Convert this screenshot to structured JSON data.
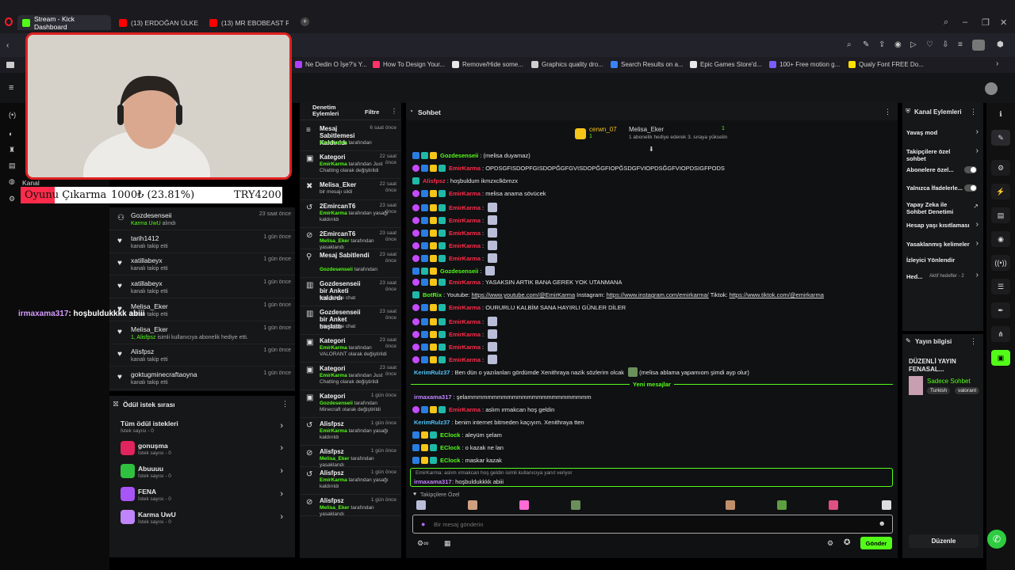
{
  "browser": {
    "tabs": [
      {
        "title": "Stream - Kick Dashboard",
        "color": "#53fc18"
      },
      {
        "title": "(13) ERDOĞAN ÜLKEYİ BO",
        "color": "#ff0000"
      },
      {
        "title": "(13) MR EBOBEAST REZİL",
        "color": "#ff0000"
      }
    ],
    "bookmarks": [
      "Ne Dedin O İşe?'s Y...",
      "How To Design Your...",
      "Remove/Hide some...",
      "Graphics quality dro...",
      "Search Results on a...",
      "Epic Games Store'd...",
      "100+ Free motion g...",
      "Qualy Font FREE Do..."
    ]
  },
  "overlay": {
    "goal_label": "Oyunu Çıkarma",
    "goal_amount": "1000₺ (23.81%)",
    "goal_total": "TRY4200",
    "goal_progress": 0.2381,
    "chat_user": "irmaxama317",
    "chat_text": ": hoşbuldukkkk abiii"
  },
  "leftnav": {
    "channel_label": "Kanal"
  },
  "activity": [
    {
      "name": "Gozdesenseii",
      "detail_green": "Karma UwU",
      "detail": " alındı",
      "time": "23 saat önce"
    },
    {
      "name": "tarih1412",
      "detail_green": "",
      "detail": "kanalı takip etti",
      "time": "1 gün önce"
    },
    {
      "name": "xatillabeyx",
      "detail_green": "",
      "detail": "kanalı takip etti",
      "time": "1 gün önce"
    },
    {
      "name": "xatillabeyx",
      "detail_green": "",
      "detail": "kanalı takip etti",
      "time": "1 gün önce"
    },
    {
      "name": "Melisa_Eker",
      "detail_green": "",
      "detail": "kanalı takip etti",
      "time": "1 gün önce"
    },
    {
      "name": "Melisa_Eker",
      "detail_green": "1, Alisfpsz",
      "detail": " isimli kullanıcıya abonelik hediye etti.",
      "time": "1 gün önce"
    },
    {
      "name": "Alisfpsz",
      "detail_green": "",
      "detail": "kanalı takip etti",
      "time": "1 gün önce"
    },
    {
      "name": "goktugminecraftaoyna",
      "detail_green": "",
      "detail": "kanalı takip etti",
      "time": "1 gün önce"
    }
  ],
  "rewards": {
    "title": "Ödül istek sırası",
    "all_label": "Tüm ödül istekleri",
    "all_count": "İstek sayısı - 0",
    "items": [
      {
        "name": "gonuşma",
        "count": "İstek sayısı - 0",
        "color": "#e0245e"
      },
      {
        "name": "Abuuuu",
        "count": "İstek sayısı - 0",
        "color": "#30c040"
      },
      {
        "name": "FENA",
        "count": "İstek sayısı - 0",
        "color": "#a855f7"
      },
      {
        "name": "Karma UwU",
        "count": "İstek sayısı - 0",
        "color": "#c084fc"
      }
    ]
  },
  "moderation": {
    "title": "Denetim Eylemleri",
    "filter": "Filtre",
    "items": [
      {
        "icon": "≡",
        "title": "Mesaj Sabitlemesi Kaldırıldı",
        "time": "6 saat önce",
        "actor": "EmirKarma",
        "desc": " tarafından"
      },
      {
        "icon": "▣",
        "title": "Kategori",
        "time": "22 saat önce",
        "actor": "EmirKarma",
        "desc": " tarafından Just Chatting olarak değiştirildi"
      },
      {
        "icon": "✖",
        "title": "Melisa_Eker",
        "time": "22 saat önce",
        "actor": "",
        "desc": "bir mesajı sildi"
      },
      {
        "icon": "↺",
        "title": "2EmircanT6",
        "time": "23 saat önce",
        "actor": "EmirKarma",
        "desc": " tarafından yasağı kaldırıldı"
      },
      {
        "icon": "⊘",
        "title": "2EmircanT6",
        "time": "23 saat önce",
        "actor": "Melisa_Eker",
        "desc": " tarafından yasaklandı"
      },
      {
        "icon": "⚲",
        "title": "Mesaj Sabitlendi",
        "time": "23 saat önce",
        "actor": "Gozdesenseii",
        "desc": " tarafından"
      },
      {
        "icon": "▥",
        "title": "Gozdesenseii bir Anketi kaldırdı",
        "time": "23 saat önce",
        "actor": "",
        "desc": "win or lose chat"
      },
      {
        "icon": "▥",
        "title": "Gozdesenseii bir Anket başlattı",
        "time": "23 saat önce",
        "actor": "",
        "desc": "win or lose chat"
      },
      {
        "icon": "▣",
        "title": "Kategori",
        "time": "23 saat önce",
        "actor": "EmirKarma",
        "desc": " tarafından VALORANT olarak değiştirildi"
      },
      {
        "icon": "▣",
        "title": "Kategori",
        "time": "23 saat önce",
        "actor": "EmirKarma",
        "desc": " tarafından Just Chatting olarak değiştirildi"
      },
      {
        "icon": "▣",
        "title": "Kategori",
        "time": "1 gün önce",
        "actor": "Gozdesenseii",
        "desc": " tarafından Minecraft olarak değiştirildi"
      },
      {
        "icon": "↺",
        "title": "Alisfpsz",
        "time": "1 gün önce",
        "actor": "EmirKarma",
        "desc": " tarafından yasağı kaldırıldı"
      },
      {
        "icon": "⊘",
        "title": "Alisfpsz",
        "time": "1 gün önce",
        "actor": "Melisa_Eker",
        "desc": " tarafından yasaklandı"
      },
      {
        "icon": "↺",
        "title": "Alisfpsz",
        "time": "1 gün önce",
        "actor": "EmirKarma",
        "desc": " tarafından yasağı kaldırıldı"
      },
      {
        "icon": "⊘",
        "title": "Alisfpsz",
        "time": "1 gün önce",
        "actor": "Melisa_Eker",
        "desc": " tarafından yasaklandı"
      }
    ]
  },
  "chat": {
    "title": "Sohbet",
    "top_gifter": {
      "name": "cerwn_07",
      "count": "1",
      "other": "Melisa_Eker",
      "other_count": "1",
      "note": "1 abonelik hediye ederek 3. sıraya yükselin"
    },
    "messages": [
      {
        "user": "Gozdesenseii",
        "color": "#53fc18",
        "badges": [
          "blue",
          "cyan",
          "gold"
        ],
        "text": ": (melisa duyamaz)",
        "emotes": 0
      },
      {
        "user": "EmirKarma",
        "color": "#ff2b4a",
        "badges": [
          "purple",
          "blue",
          "gold",
          "cyan"
        ],
        "text": ": OPDSGFISDOPFGISDOPĞGFGVISDOPĞGFIOPĞSDGFVIOPDSĞGFVIOPDSIGFPODS",
        "emotes": 0
      },
      {
        "user": "Alisfpsz",
        "color": "#ff2b4a",
        "badges": [
          "cyan"
        ],
        "text": ": hoşbuldum ikmzxclkbmzx",
        "emotes": 0
      },
      {
        "user": "EmirKarma",
        "color": "#ff2b4a",
        "badges": [
          "purple",
          "blue",
          "gold",
          "cyan"
        ],
        "text": ": melisa anama sövücek",
        "emotes": 0
      },
      {
        "user": "EmirKarma",
        "color": "#ff2b4a",
        "badges": [
          "purple",
          "blue",
          "gold",
          "cyan"
        ],
        "text": ":",
        "emotes": 1
      },
      {
        "user": "EmirKarma",
        "color": "#ff2b4a",
        "badges": [
          "purple",
          "blue",
          "gold",
          "cyan"
        ],
        "text": ":",
        "emotes": 1
      },
      {
        "user": "EmirKarma",
        "color": "#ff2b4a",
        "badges": [
          "purple",
          "blue",
          "gold",
          "cyan"
        ],
        "text": ":",
        "emotes": 1
      },
      {
        "user": "EmirKarma",
        "color": "#ff2b4a",
        "badges": [
          "purple",
          "blue",
          "gold",
          "cyan"
        ],
        "text": ":",
        "emotes": 1
      },
      {
        "user": "EmirKarma",
        "color": "#ff2b4a",
        "badges": [
          "purple",
          "blue",
          "gold",
          "cyan"
        ],
        "text": ":",
        "emotes": 1
      },
      {
        "user": "Gozdesenseii",
        "color": "#53fc18",
        "badges": [
          "blue",
          "cyan",
          "gold"
        ],
        "text": ":",
        "emotes": 1
      },
      {
        "user": "EmirKarma",
        "color": "#ff2b4a",
        "badges": [
          "purple",
          "blue",
          "gold",
          "cyan"
        ],
        "text": ": YASAKSIN ARTIK BANA GEREK YOK UTANMANA",
        "emotes": 0
      }
    ],
    "botrix": {
      "user": "BotRix",
      "prefix": ": Youtube: ",
      "yt": "https://www.youtube.com/@EmirKarma",
      "ig_label": " Instagram: ",
      "ig": "https://www.instagram.com/emirkarma/",
      "tt_label": " Tiktok: ",
      "tt": "https://www.tiktok.com/@emirkarma"
    },
    "messages2": [
      {
        "user": "EmirKarma",
        "color": "#ff2b4a",
        "badges": [
          "purple",
          "blue",
          "gold",
          "cyan"
        ],
        "text": ": OURURLU KALBİM SANA HAYIRLI GÜNLER DİLER",
        "emotes": 0
      },
      {
        "user": "EmirKarma",
        "color": "#ff2b4a",
        "badges": [
          "purple",
          "blue",
          "gold",
          "cyan"
        ],
        "text": ":",
        "emotes": 1
      },
      {
        "user": "EmirKarma",
        "color": "#ff2b4a",
        "badges": [
          "purple",
          "blue",
          "gold",
          "cyan"
        ],
        "text": ":",
        "emotes": 1
      },
      {
        "user": "EmirKarma",
        "color": "#ff2b4a",
        "badges": [
          "purple",
          "blue",
          "gold",
          "cyan"
        ],
        "text": ":",
        "emotes": 1
      },
      {
        "user": "EmirKarma",
        "color": "#ff2b4a",
        "badges": [
          "purple",
          "blue",
          "gold",
          "cyan"
        ],
        "text": ":",
        "emotes": 1
      },
      {
        "user": "KerimRulz37",
        "color": "#4fc3f7",
        "badges": [],
        "text": ": Ben dün o yazılanları gördümde Xenithraya nazik sözlerim olcak",
        "emotes": 0,
        "tail": " (melisa ablama yapamıom şimdi ayp olur)"
      }
    ],
    "new_messages_label": "Yeni mesajlar",
    "messages3": [
      {
        "user": "irmaxama317",
        "color": "#c084fc",
        "badges": [],
        "text": ": şelammmmmmmmmmmmmmmmmmmmmmmmm",
        "emotes": 0
      },
      {
        "user": "EmirKarma",
        "color": "#ff2b4a",
        "badges": [
          "purple",
          "blue",
          "gold",
          "cyan"
        ],
        "text": ": aslım ırmakcan hoş geldin",
        "emotes": 0
      },
      {
        "user": "KerimRulz37",
        "color": "#4fc3f7",
        "badges": [],
        "text": ": benim internet bitmeden kaçıyım. Xenithraya tten",
        "emotes": 0
      },
      {
        "user": "EClock",
        "color": "#53fc18",
        "badges": [
          "blue",
          "gold",
          "cyan"
        ],
        "text": ": aleyüm şelam",
        "emotes": 0
      },
      {
        "user": "EClock",
        "color": "#53fc18",
        "badges": [
          "blue",
          "gold",
          "cyan"
        ],
        "text": ": o kazak ne lan",
        "emotes": 0
      },
      {
        "user": "EClock",
        "color": "#53fc18",
        "badges": [
          "blue",
          "gold",
          "cyan"
        ],
        "text": ": maskar kazak",
        "emotes": 0
      }
    ],
    "reply": {
      "context": "EmirKarma: aslım ırmakcan hoş geldin isimli kullanıcıya yanıt veriyor",
      "user": "irmaxama317",
      "text": ": hoşbuldukkkk abiii"
    },
    "followers_only": "Takipçilere Özel",
    "input_placeholder": "Bir mesaj gönderin",
    "send_label": "Gönder"
  },
  "actions": {
    "title": "Kanal Eylemleri",
    "items": [
      {
        "label": "Yavaş mod",
        "type": "arrow"
      },
      {
        "label": "Takipçilere özel sohbet",
        "type": "arrow"
      },
      {
        "label": "Abonelere özel...",
        "type": "toggle"
      },
      {
        "label": "Yalnızca İfadelerle...",
        "type": "toggle"
      },
      {
        "label": "Yapay Zeka ile Sohbet Denetimi",
        "type": "ext"
      },
      {
        "label": "Hesap yaşı kısıtlaması",
        "type": "arrow"
      },
      {
        "label": "Yasaklanmış kelimeler",
        "type": "arrow"
      },
      {
        "label": "İzleyici Yönlendir",
        "type": "none"
      }
    ],
    "hedef_label": "Hed...",
    "hedef_sub": "Aktif hedefler - 2"
  },
  "streaminfo": {
    "title": "Yayın bilgisi",
    "stream_title": "DÜZENLİ YAYIN FENASAL...",
    "category": "Sadece Sohbet",
    "tags": [
      "Turkish",
      "valorant"
    ],
    "edit_label": "Düzenle"
  }
}
